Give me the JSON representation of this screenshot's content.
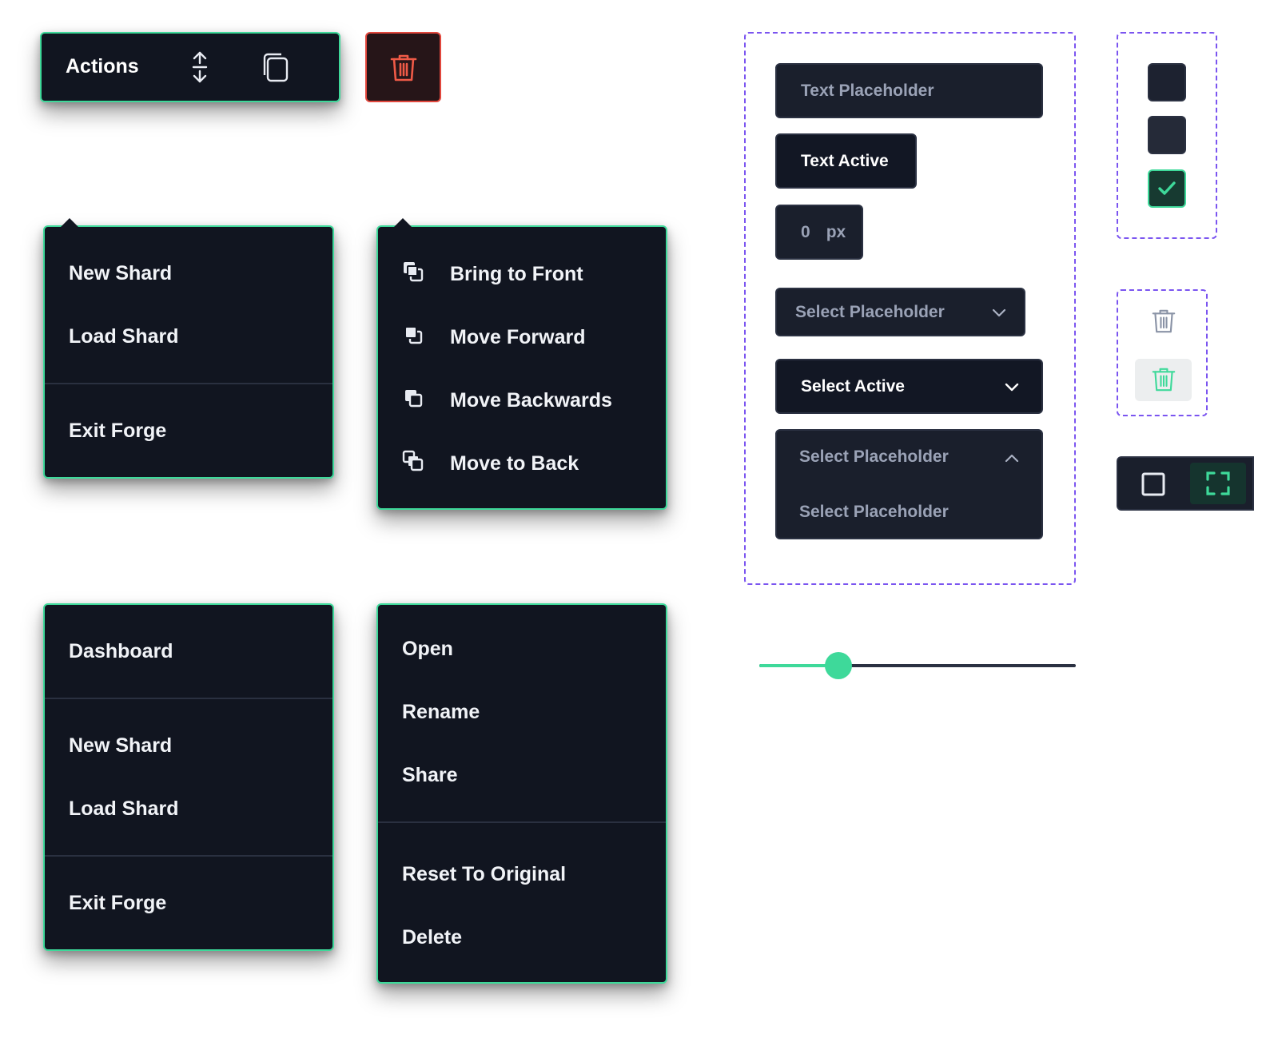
{
  "toolbar": {
    "actions_label": "Actions"
  },
  "menu_file": {
    "items": [
      "New Shard",
      "Load Shard",
      "Exit Forge"
    ]
  },
  "menu_arrange": {
    "items": [
      "Bring to Front",
      "Move Forward",
      "Move Backwards",
      "Move to Back"
    ]
  },
  "menu_nav": {
    "items": [
      "Dashboard",
      "New Shard",
      "Load Shard",
      "Exit Forge"
    ]
  },
  "menu_item": {
    "items": [
      "Open",
      "Rename",
      "Share",
      "Reset To Original",
      "Delete"
    ]
  },
  "inputs": {
    "text_placeholder": "Text Placeholder",
    "text_active": "Text Active",
    "number_value": "0",
    "number_unit": "px"
  },
  "selects": {
    "placeholder": "Select Placeholder",
    "active": "Select Active",
    "open_value": "Select Placeholder",
    "open_options": [
      "Select Placeholder"
    ]
  },
  "checkboxes": [
    {
      "state": "unchecked"
    },
    {
      "state": "unchecked"
    },
    {
      "state": "checked"
    }
  ],
  "slider": {
    "value": 0.25
  },
  "colors": {
    "accent": "#3ed99a",
    "panel": "#111520",
    "field": "#1a1f2c",
    "danger": "#e1473d",
    "dashed": "#7b55f0"
  },
  "icons": [
    "sort-icon",
    "copy-icon",
    "trash-icon",
    "bring-to-front-icon",
    "move-forward-icon",
    "move-backwards-icon",
    "move-to-back-icon",
    "chevron-down-icon",
    "chevron-up-icon",
    "check-icon",
    "square-icon",
    "fullscreen-icon"
  ]
}
